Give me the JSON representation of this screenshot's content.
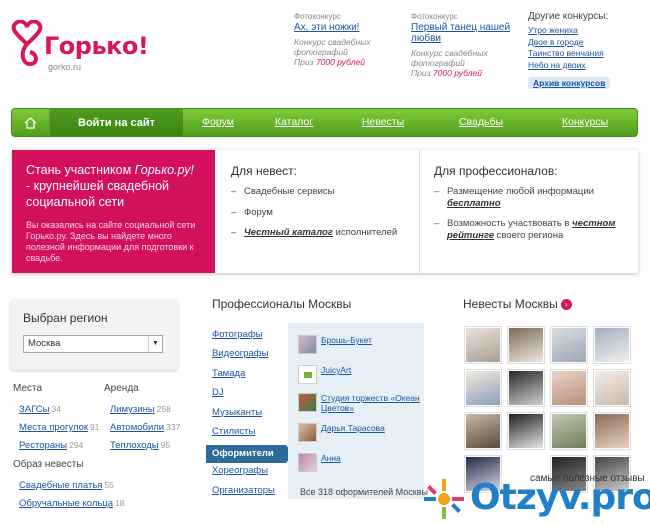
{
  "header": {
    "logo_text": "Горько!",
    "logo_sub": "gorko.ru",
    "contests": [
      {
        "kind": "Фотоконкурс",
        "title": "Ах, эти ножки!",
        "desc": "Конкурс свадебных фотографий",
        "prize_label": "Приз",
        "prize_value": "7000 рублей"
      },
      {
        "kind": "Фотоконкурс",
        "title": "Первый танец нашей любви",
        "desc": "Конкурс свадебных фотографий",
        "prize_label": "Приз",
        "prize_value": "7000 рублей"
      }
    ],
    "other_contests": {
      "title": "Другие конкурсы:",
      "items": [
        "Утро жениха",
        "Двое в городе",
        "Таинство венчания",
        "Небо на двоих"
      ],
      "archive": "Архив конкурсов"
    }
  },
  "nav": {
    "login": "Войти на сайт",
    "items": [
      "Форум",
      "Каталог",
      "Невесты",
      "Свадьбы",
      "Конкурсы"
    ]
  },
  "hero": {
    "title_pre": "Стань участником ",
    "title_brand": "Горько.ру!",
    "title_post": " - крупнейшей свадебной социальной сети",
    "text": "Вы оказались на сайте социальной сети Горько.ру. Здесь вы найдете много полезной информации для подготовки к свадьбе.",
    "brides": {
      "title": "Для невест:",
      "item1": "Свадебные сервисы",
      "item2": "Форум",
      "item3_bold": "Честный каталог",
      "item3_rest": " исполнителей"
    },
    "pros": {
      "title": "Для профессионалов:",
      "item1_text": "Размещение любой информации ",
      "item1_bold": "бесплатно",
      "item2_text": "Возможность участвовать в ",
      "item2_bold": "честном рейтинге",
      "item2_rest": " своего региона"
    }
  },
  "region": {
    "title": "Выбран регион",
    "selected": "Москва"
  },
  "categories": {
    "places_title": "Места",
    "places": [
      {
        "label": "ЗАГСы",
        "count": "34"
      },
      {
        "label": "Места прогулок",
        "count": "91"
      },
      {
        "label": "Рестораны",
        "count": "294"
      }
    ],
    "rent_title": "Аренда",
    "rent": [
      {
        "label": "Лимузины",
        "count": "258"
      },
      {
        "label": "Автомобили",
        "count": "337"
      },
      {
        "label": "Теплоходы",
        "count": "95"
      }
    ],
    "bride_look_title": "Образ невесты",
    "bride_look": [
      {
        "label": "Свадебные платья",
        "count": "55"
      },
      {
        "label": "Обручальные кольца",
        "count": "18"
      }
    ]
  },
  "professionals": {
    "title": "Профессионалы Москвы",
    "menu": [
      "Фотографы",
      "Видеографы",
      "Тамада",
      "DJ",
      "Музыканты",
      "Стилисты",
      "Оформители",
      "Хореографы",
      "Организаторы"
    ],
    "active_index": 6,
    "list": [
      "Брошь-Букет",
      "JuicyArt",
      "Студия торжеств «Океан Цветов»",
      "Дарья Тарасова",
      "Анна"
    ],
    "all_link": "Все 318 оформителей Москвы"
  },
  "brides": {
    "title": "Невесты Москвы",
    "go": "›"
  },
  "watermark": {
    "caption": "самые полезные отзывы",
    "brand": "Otzyv.pro"
  },
  "colors": {
    "brand_pink": "#d3105e",
    "nav_green": "#5aae24",
    "link_blue": "#1a56a8",
    "active_menu": "#2c6b9c"
  }
}
